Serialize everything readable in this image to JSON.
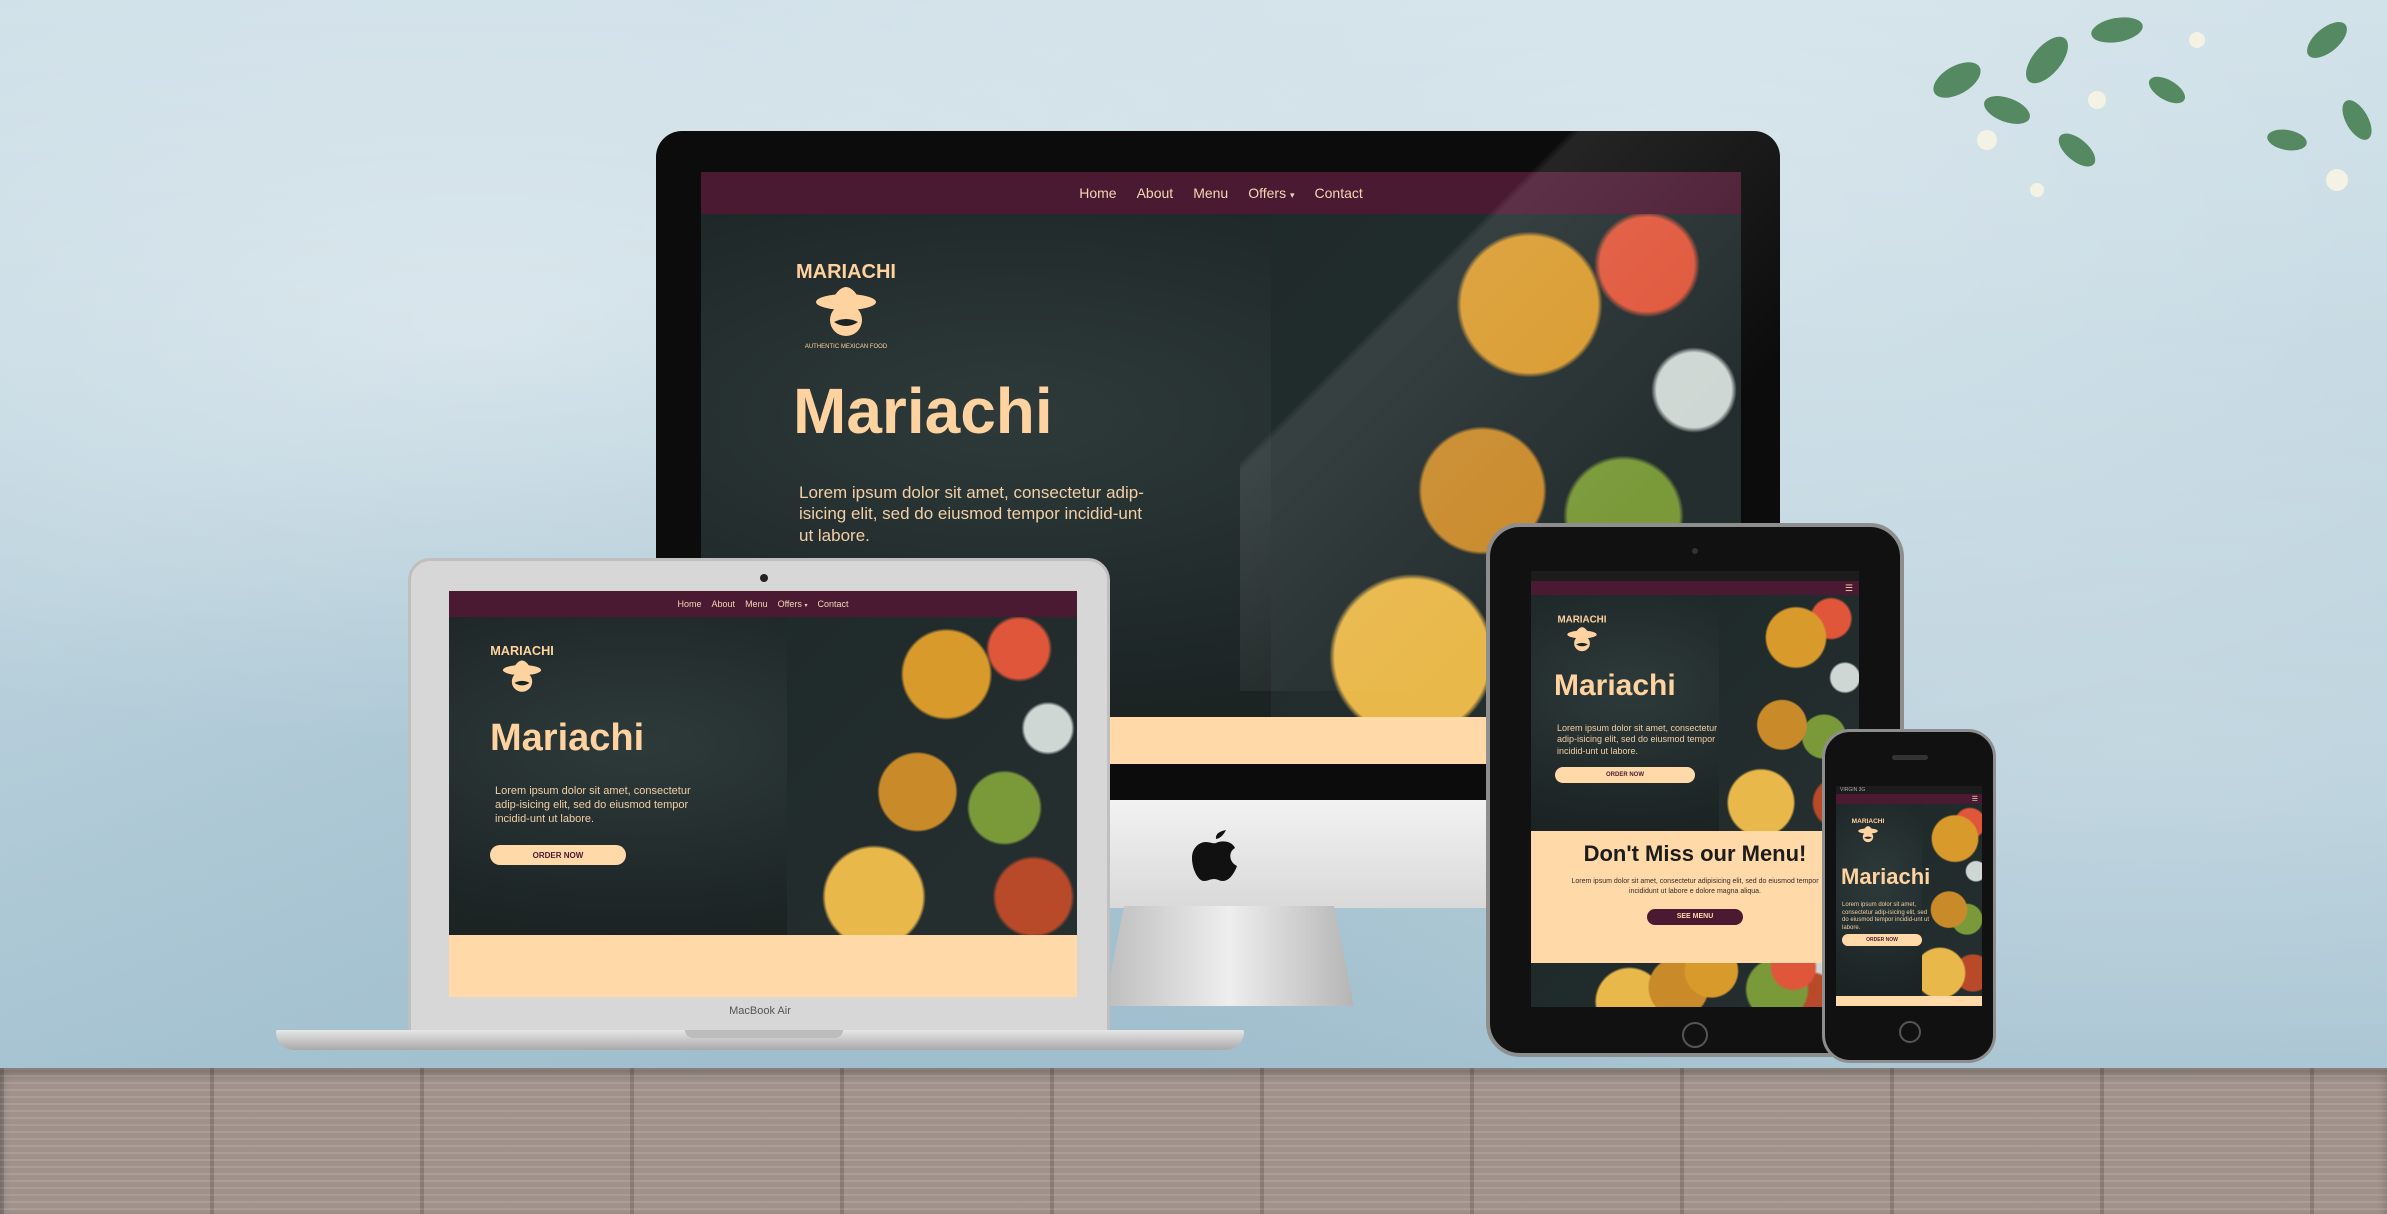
{
  "site": {
    "nav": [
      "Home",
      "About",
      "Menu",
      "Offers",
      "Contact"
    ],
    "offers_caret": "▾",
    "logo_text": "MARIACHI",
    "logo_tagline": "AUTHENTIC MEXICAN FOOD",
    "brand": "Mariachi",
    "lede": "Lorem ipsum dolor sit amet, consectetur adip-isicing elit, sed do eiusmod tempor incidid-unt ut labore.",
    "order_button": "ORDER NOW",
    "offer_title": "Don't Miss our Menu!",
    "offer_text": "Lorem ipsum dolor sit amet, consectetur adipisicing elit, sed do eiusmod tempor incididunt ut labore e dolore magna aliqua.",
    "menu_button": "SEE MENU"
  },
  "devices": {
    "laptop_label": "MacBook Air",
    "phone_status": "VIRGIN  3G"
  },
  "colors": {
    "nav_bg": "#4a1a33",
    "accent": "#ffd9a8",
    "hero_bg": "#1b2323"
  }
}
